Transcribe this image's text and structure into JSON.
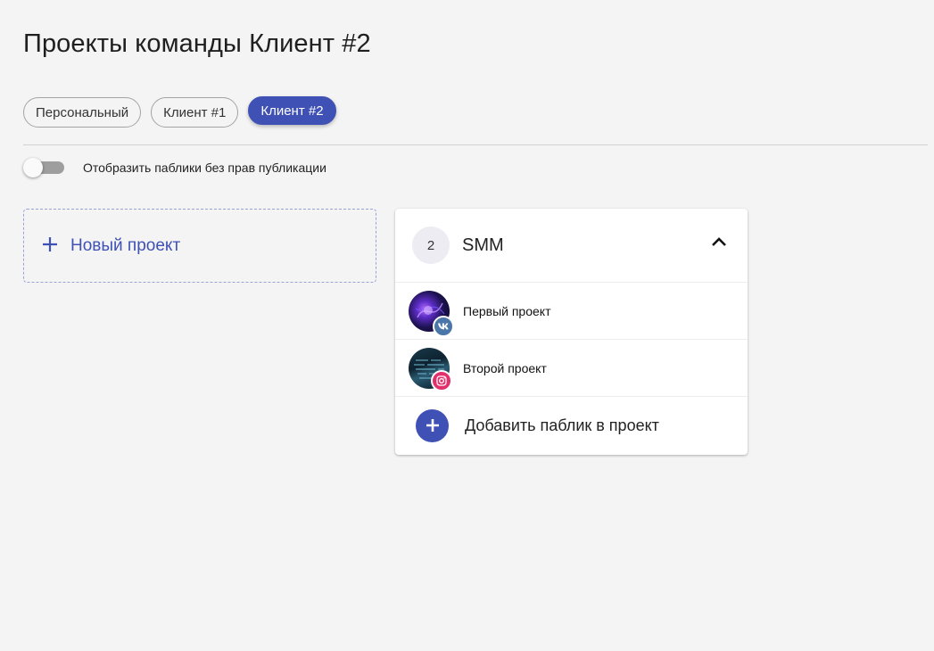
{
  "page": {
    "title": "Проекты команды Клиент #2"
  },
  "teams": {
    "chips": [
      {
        "label": "Персональный",
        "active": false
      },
      {
        "label": "Клиент #1",
        "active": false
      },
      {
        "label": "Клиент #2",
        "active": true
      }
    ]
  },
  "filter": {
    "toggle_label": "Отобразить паблики без прав публикации",
    "toggle_on": false
  },
  "new_project": {
    "label": "Новый проект",
    "icon": "plus-icon"
  },
  "project": {
    "count": "2",
    "name": "SMM",
    "expanded": true,
    "publics": [
      {
        "name": "Первый проект",
        "network": "vk",
        "icon": "vk-icon"
      },
      {
        "name": "Второй проект",
        "network": "instagram",
        "icon": "instagram-icon"
      }
    ],
    "add_label": "Добавить паблик в проект"
  },
  "colors": {
    "accent": "#3f51b5",
    "background": "#f4f4f4",
    "vk": "#4a76a8",
    "instagram": "#e1306c"
  }
}
